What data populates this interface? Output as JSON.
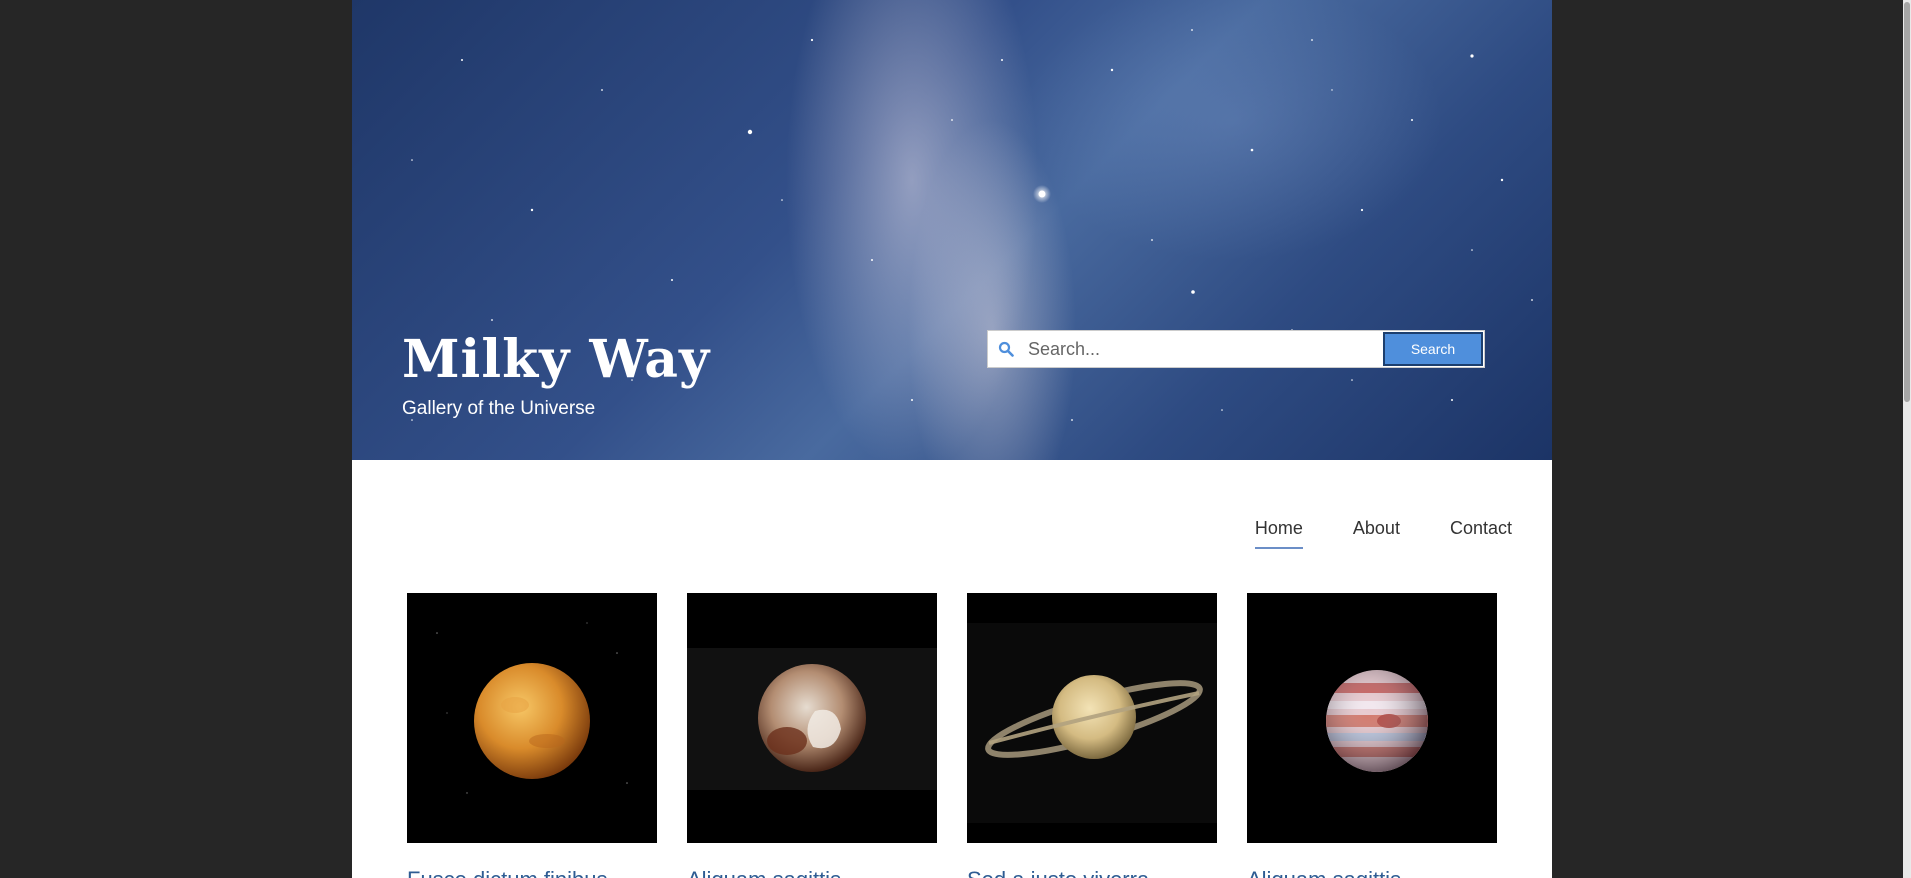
{
  "brand": {
    "title": "Milky Way",
    "tagline": "Gallery of the Universe"
  },
  "search": {
    "icon": "search-icon",
    "placeholder": "Search...",
    "button_label": "Search",
    "accent_color": "#4f8fdc"
  },
  "nav": {
    "items": [
      {
        "label": "Home",
        "active": true
      },
      {
        "label": "About",
        "active": false
      },
      {
        "label": "Contact",
        "active": false
      }
    ]
  },
  "gallery": {
    "cards": [
      {
        "image": "venus-planet",
        "title": "Fusce dictum finibus"
      },
      {
        "image": "pluto-planet",
        "title": "Aliquam sagittis"
      },
      {
        "image": "saturn-planet",
        "title": "Sed a justo viverra"
      },
      {
        "image": "jupiter-planet",
        "title": "Aliquam sagittis"
      }
    ]
  }
}
